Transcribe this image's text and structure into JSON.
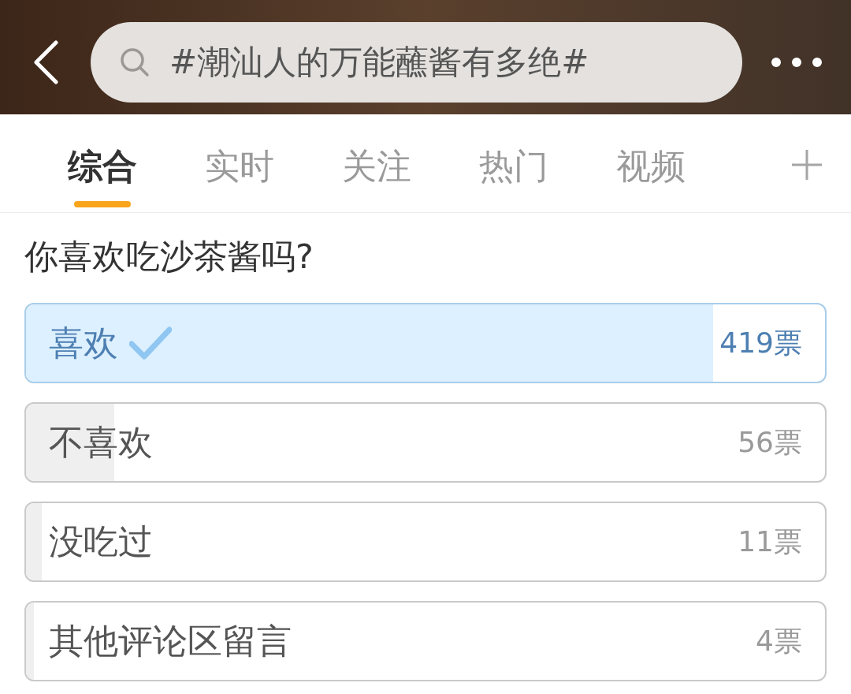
{
  "header": {
    "search": {
      "value": "#潮汕人的万能蘸酱有多绝#"
    }
  },
  "tabs": [
    {
      "label": "综合",
      "selected": true
    },
    {
      "label": "实时",
      "selected": false
    },
    {
      "label": "关注",
      "selected": false
    },
    {
      "label": "热门",
      "selected": false
    },
    {
      "label": "视频",
      "selected": false
    }
  ],
  "poll": {
    "question": "你喜欢吃沙茶酱吗?",
    "options": [
      {
        "label": "喜欢",
        "votes": "419票",
        "selected": true,
        "level": 0.86
      },
      {
        "label": "不喜欢",
        "votes": "56票",
        "selected": false,
        "level": 0.11
      },
      {
        "label": "没吃过",
        "votes": "11票",
        "selected": false,
        "level": 0.02
      },
      {
        "label": "其他评论区留言",
        "votes": "4票",
        "selected": false,
        "level": 0.01
      }
    ]
  }
}
